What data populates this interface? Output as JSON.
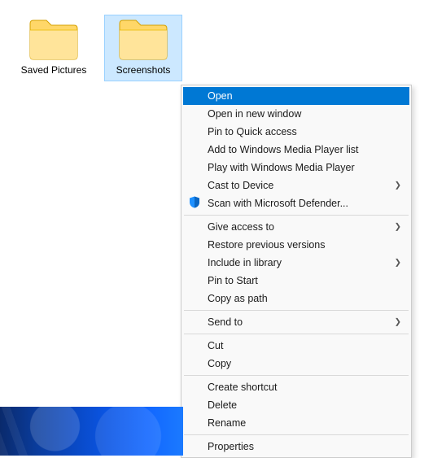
{
  "folders": [
    {
      "label": "Saved Pictures",
      "selected": false
    },
    {
      "label": "Screenshots",
      "selected": true
    }
  ],
  "context_menu": {
    "groups": [
      [
        {
          "label": "Open",
          "highlighted": true
        },
        {
          "label": "Open in new window"
        },
        {
          "label": "Pin to Quick access"
        },
        {
          "label": "Add to Windows Media Player list"
        },
        {
          "label": "Play with Windows Media Player"
        },
        {
          "label": "Cast to Device",
          "submenu": true
        },
        {
          "label": "Scan with Microsoft Defender...",
          "icon": "defender-shield-icon"
        }
      ],
      [
        {
          "label": "Give access to",
          "submenu": true
        },
        {
          "label": "Restore previous versions"
        },
        {
          "label": "Include in library",
          "submenu": true
        },
        {
          "label": "Pin to Start"
        },
        {
          "label": "Copy as path"
        }
      ],
      [
        {
          "label": "Send to",
          "submenu": true
        }
      ],
      [
        {
          "label": "Cut"
        },
        {
          "label": "Copy"
        }
      ],
      [
        {
          "label": "Create shortcut"
        },
        {
          "label": "Delete"
        },
        {
          "label": "Rename"
        }
      ],
      [
        {
          "label": "Properties"
        }
      ]
    ]
  }
}
